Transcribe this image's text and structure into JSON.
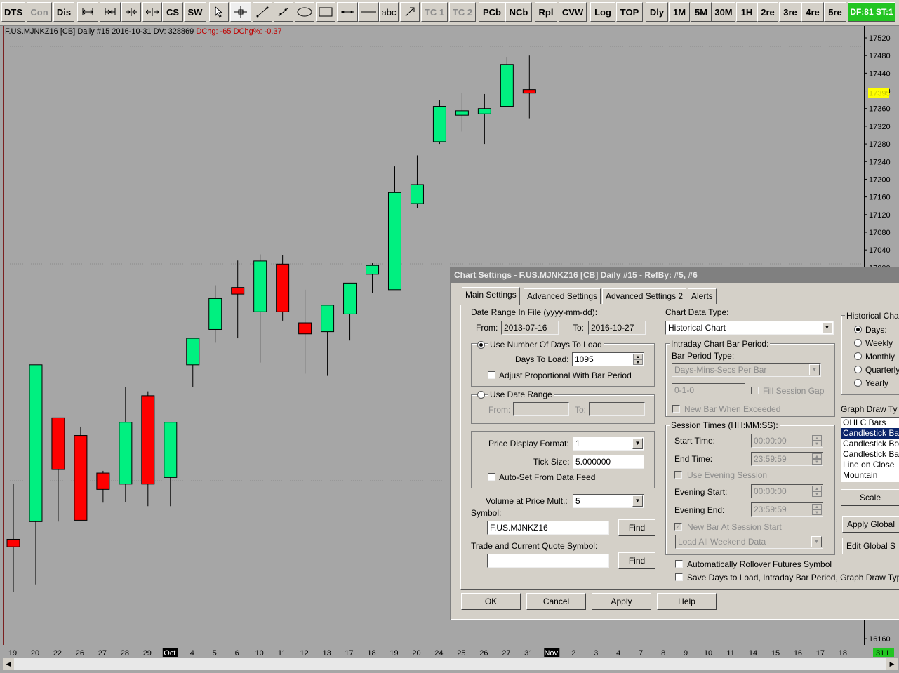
{
  "toolbar": {
    "buttons": [
      {
        "label": "DTS",
        "disabled": false
      },
      {
        "label": "Con",
        "disabled": true
      },
      {
        "label": "Dis",
        "disabled": false
      },
      {
        "label": "CS",
        "disabled": false
      },
      {
        "label": "SW",
        "disabled": false
      },
      {
        "label": "abc",
        "disabled": false
      },
      {
        "label": "TC 1",
        "disabled": true
      },
      {
        "label": "TC 2",
        "disabled": true
      },
      {
        "label": "PCb",
        "disabled": false
      },
      {
        "label": "NCb",
        "disabled": false
      },
      {
        "label": "Rpl",
        "disabled": false
      },
      {
        "label": "CVW",
        "disabled": false
      },
      {
        "label": "Log",
        "disabled": false
      },
      {
        "label": "TOP",
        "disabled": false
      },
      {
        "label": "Dly",
        "disabled": false
      },
      {
        "label": "1M",
        "disabled": false
      },
      {
        "label": "5M",
        "disabled": false
      },
      {
        "label": "30M",
        "disabled": false
      },
      {
        "label": "1H",
        "disabled": false
      },
      {
        "label": "2re",
        "disabled": false
      },
      {
        "label": "3re",
        "disabled": false
      },
      {
        "label": "4re",
        "disabled": false
      },
      {
        "label": "5re",
        "disabled": false
      }
    ],
    "status": "DF:81  ST:1"
  },
  "chart_header": {
    "symbol": "F.US.MJNKZ16 [CB]",
    "period": "Daily",
    "chart_num": "#15",
    "date": "2016-10-31",
    "dv": "DV: 328869",
    "dchg": "DChg: -65",
    "dchgpct": "DChg%: -0.37"
  },
  "colors": {
    "up": "#00f080",
    "down": "#ff0000",
    "background": "#a6a6a6",
    "price_marker": "#ffff00"
  },
  "chart_data": {
    "type": "candlestick",
    "x": [
      "19",
      "20",
      "22",
      "26",
      "27",
      "28",
      "29",
      "Oct",
      "4",
      "5",
      "6",
      "10",
      "11",
      "12",
      "13",
      "17",
      "18",
      "19",
      "20",
      "24",
      "25",
      "26",
      "27",
      "31"
    ],
    "open": [
      16385,
      16425,
      16660,
      16620,
      16535,
      16510,
      16710,
      16525,
      16780,
      16860,
      16955,
      16900,
      17008,
      16875,
      16855,
      16895,
      16985,
      16950,
      17145,
      17285,
      17345,
      17348,
      17365,
      17403
    ],
    "high": [
      16510,
      16775,
      16650,
      16640,
      16540,
      16730,
      16720,
      16545,
      16800,
      16960,
      17016,
      17030,
      17028,
      16950,
      16860,
      16955,
      17010,
      17229,
      17254,
      17380,
      17395,
      17393,
      17477,
      17480
    ],
    "low": [
      16265,
      16283,
      16425,
      16460,
      16468,
      16470,
      16460,
      16460,
      16730,
      16830,
      16840,
      16785,
      16880,
      16760,
      16755,
      16835,
      16942,
      16950,
      17135,
      17280,
      17308,
      17280,
      17368,
      17338
    ],
    "close": [
      16368,
      16780,
      16543,
      16428,
      16498,
      16650,
      16510,
      16650,
      16840,
      16930,
      16940,
      17015,
      16900,
      16850,
      16915,
      16965,
      17005,
      17170,
      17188,
      17365,
      17355,
      17360,
      17460,
      17395
    ],
    "ylim": [
      16145,
      17545
    ],
    "y_ticks": [
      17520,
      17480,
      17440,
      17400,
      17360,
      17320,
      17280,
      17240,
      17200,
      17160,
      17120,
      17080,
      17040,
      17000,
      16160
    ],
    "last_price": "17395",
    "x_axis_labels": [
      "19",
      "20",
      "22",
      "26",
      "27",
      "28",
      "29",
      "Oct",
      "4",
      "5",
      "6",
      "10",
      "11",
      "12",
      "13",
      "17",
      "18",
      "19",
      "20",
      "24",
      "25",
      "26",
      "27",
      "31",
      "Nov",
      "2",
      "3",
      "4",
      "7",
      "8",
      "9",
      "10",
      "11",
      "14",
      "15",
      "16",
      "17",
      "18"
    ],
    "x_axis_highlight": [
      "Oct",
      "Nov"
    ],
    "x_axis_end_label": "31 L"
  },
  "dialog": {
    "title": "Chart Settings - F.US.MJNKZ16 [CB]  Daily  #15 - RefBy: #5, #6",
    "tabs": [
      "Main Settings",
      "Advanced Settings",
      "Advanced Settings 2",
      "Alerts"
    ],
    "date_range_label": "Date Range In File (yyyy-mm-dd):",
    "from_label": "From:",
    "from_value": "2013-07-16",
    "to_label": "To:",
    "to_value": "2016-10-27",
    "use_days_label": "Use Number Of Days To Load",
    "days_to_load_label": "Days To Load:",
    "days_to_load_value": "1095",
    "adjust_label": "Adjust Proportional With Bar Period",
    "use_date_range_label": "Use Date Range",
    "range_from_label": "From:",
    "range_to_label": "To:",
    "price_format_label": "Price Display Format:",
    "price_format_value": "1",
    "tick_size_label": "Tick Size:",
    "tick_size_value": "5.000000",
    "autoset_label": "Auto-Set From Data Feed",
    "volume_label": "Volume at Price Mult.:",
    "volume_value": "5",
    "symbol_label": "Symbol:",
    "symbol_value": "F.US.MJNKZ16",
    "find_label": "Find",
    "trade_symbol_label": "Trade and Current Quote Symbol:",
    "trade_symbol_value": "",
    "chart_data_type_label": "Chart Data Type:",
    "chart_data_type_value": "Historical Chart",
    "intraday_label": "Intraday Chart Bar Period:",
    "bar_period_type_label": "Bar Period Type:",
    "bar_period_type_value": "Days-Mins-Secs Per Bar",
    "bar_period_value": "0-1-0",
    "fill_gap_label": "Fill Session Gap",
    "new_bar_exceeded_label": "New Bar When Exceeded",
    "session_times_label": "Session Times (HH:MM:SS):",
    "start_time_label": "Start Time:",
    "start_time_value": "00:00:00",
    "end_time_label": "End Time:",
    "end_time_value": "23:59:59",
    "use_evening_label": "Use Evening Session",
    "evening_start_label": "Evening Start:",
    "evening_start_value": "00:00:00",
    "evening_end_label": "Evening End:",
    "evening_end_value": "23:59:59",
    "new_bar_session_label": "New Bar At Session Start",
    "weekend_value": "Load All Weekend Data",
    "rollover_label": "Automatically Rollover Futures Symbol",
    "save_days_label": "Save Days to Load, Intraday Bar Period, Graph Draw Typ",
    "historical_label": "Historical Cha",
    "periods": [
      "Days:",
      "Weekly",
      "Monthly",
      "Quarterly",
      "Yearly"
    ],
    "graph_draw_label": "Graph Draw Ty",
    "graph_types": [
      "OHLC Bars",
      "Candlestick Ba",
      "Candlestick Bo",
      "Candlestick Ba",
      "Line on Close",
      "Mountain"
    ],
    "graph_selected": 1,
    "scale_label": "Scale",
    "apply_global_label": "Apply Global",
    "edit_global_label": "Edit Global S",
    "ok_label": "OK",
    "cancel_label": "Cancel",
    "apply_label": "Apply",
    "help_label": "Help"
  }
}
